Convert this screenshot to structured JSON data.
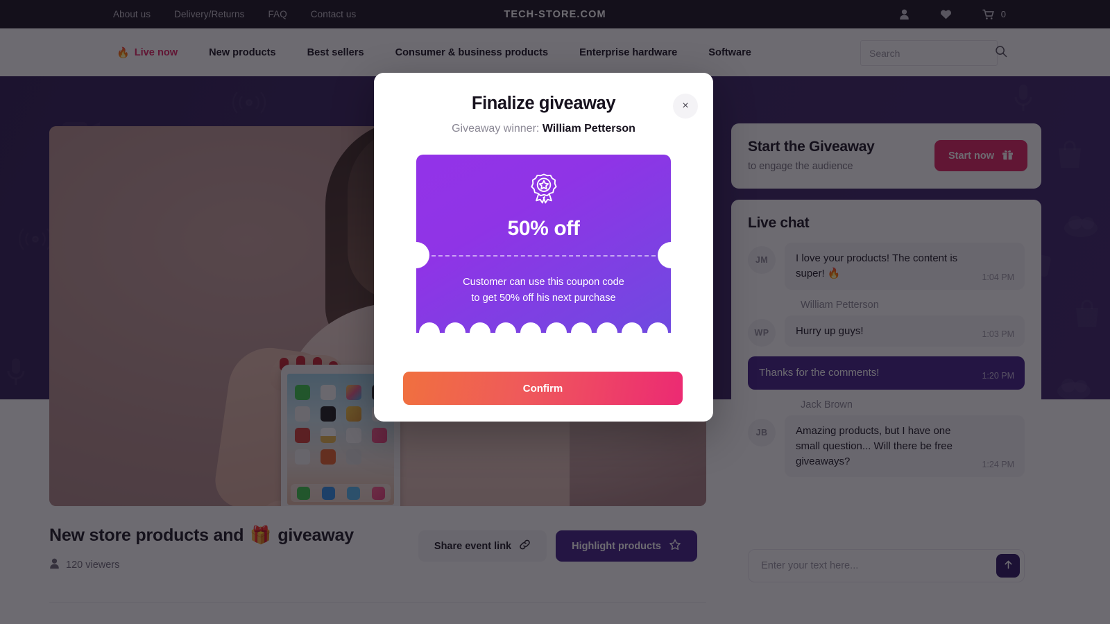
{
  "topbar": {
    "links": [
      "About us",
      "Delivery/Returns",
      "FAQ",
      "Contact us"
    ],
    "brand": "TECH-STORE.COM",
    "cart_count": "0",
    "icons": [
      "user-icon",
      "heart-icon",
      "cart-icon"
    ]
  },
  "nav": {
    "items": [
      {
        "label": "Live now",
        "live": true
      },
      {
        "label": "New products",
        "live": false
      },
      {
        "label": "Best sellers",
        "live": false
      },
      {
        "label": "Consumer & business products",
        "live": false
      },
      {
        "label": "Enterprise hardware",
        "live": false
      },
      {
        "label": "Software",
        "live": false
      }
    ],
    "search_placeholder": "Search",
    "search_value": ""
  },
  "event": {
    "title_text": "New store products and",
    "title_emoji": "🎁",
    "title_tail": "giveaway",
    "viewers": "120 viewers",
    "share_label": "Share event link",
    "highlight_label": "Highlight products"
  },
  "giveaway": {
    "heading": "Start the Giveaway",
    "subheading": "to engage the audience",
    "button_label": "Start now"
  },
  "chat": {
    "title": "Live chat",
    "input_placeholder": "Enter your text here...",
    "input_value": "",
    "messages": [
      {
        "author": "",
        "initials": "JM",
        "text": "I love your products! The content is super! 🔥",
        "time": "1:04 PM",
        "own": false,
        "show_avatar": true
      },
      {
        "author": "William Petterson",
        "initials": "WP",
        "text": "Hurry up guys!",
        "time": "1:03 PM",
        "own": false,
        "show_avatar": true
      },
      {
        "author": "",
        "initials": "",
        "text": "Thanks for the comments!",
        "time": "1:20 PM",
        "own": true,
        "show_avatar": false
      },
      {
        "author": "Jack Brown",
        "initials": "JB",
        "text": "Amazing products, but I have one small question... Will there be free giveaways?",
        "time": "1:24 PM",
        "own": false,
        "show_avatar": true
      }
    ]
  },
  "modal": {
    "title": "Finalize giveaway",
    "winner_label": "Giveaway winner:",
    "winner_name": "William Petterson",
    "close_label": "×",
    "coupon": {
      "discount": "50% off",
      "note_line1": "Customer can use this coupon code",
      "note_line2": "to get 50% off his next purchase",
      "badge_icon": "award-badge-icon"
    },
    "confirm_label": "Confirm"
  },
  "colors": {
    "brand_purple": "#3f1f86",
    "accent_pink": "#e02060",
    "coupon_from": "#9333e8",
    "coupon_to": "#6f4ae0",
    "confirm_from": "#f0703f",
    "confirm_to": "#ec2a73",
    "topbar_bg": "#17121e",
    "banner_bg": "#35205f"
  }
}
